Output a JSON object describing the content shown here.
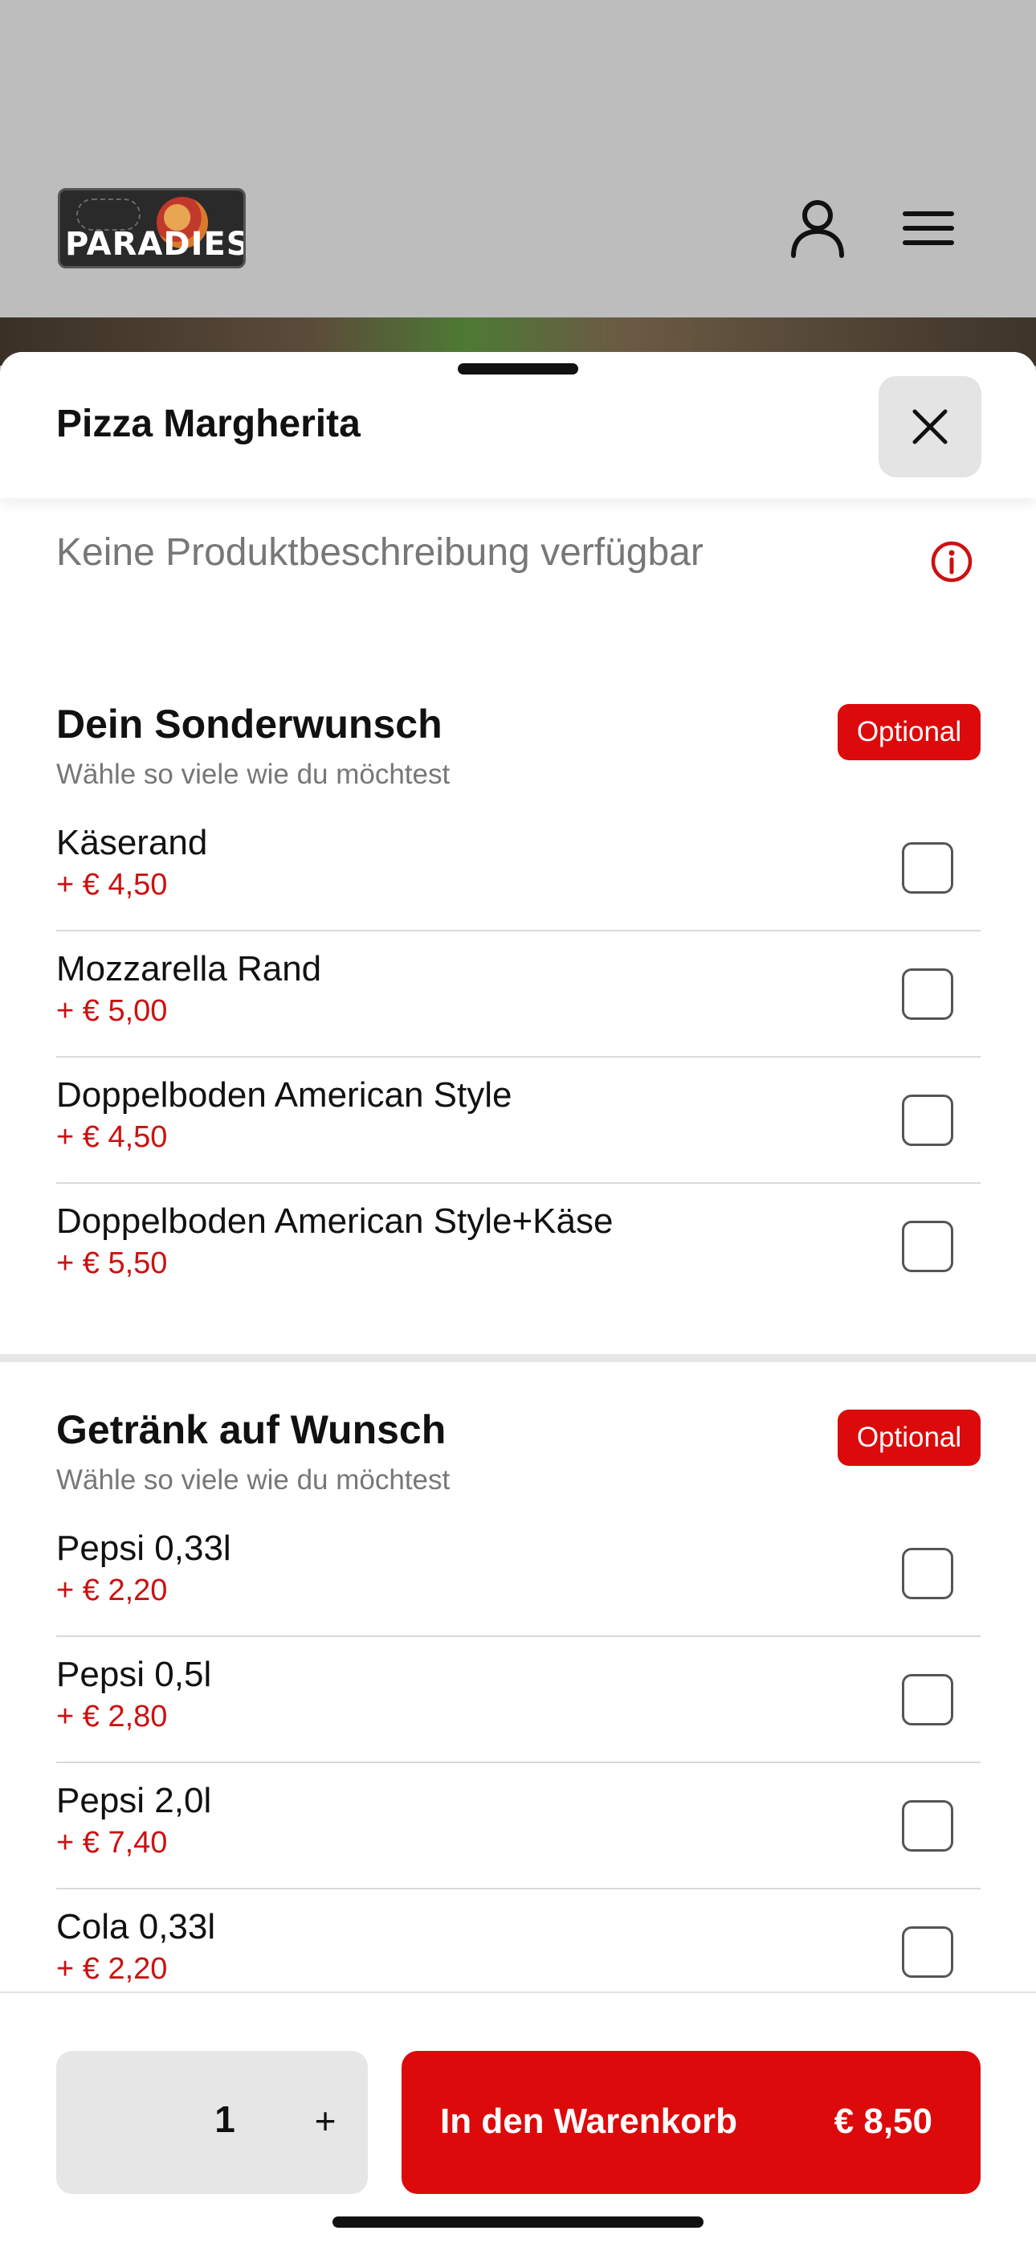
{
  "header": {
    "logo_text": "PARADIES",
    "user_icon": "user-icon",
    "menu_icon": "hamburger-menu-icon"
  },
  "sheet": {
    "title": "Pizza Margherita",
    "close_icon": "close-icon",
    "description": "Keine Produktbeschreibung verfügbar",
    "info_icon": "info-icon"
  },
  "sections": [
    {
      "title": "Dein Sonderwunsch",
      "subtitle": "Wähle so viele wie du möchtest",
      "badge": "Optional",
      "options": [
        {
          "name": "Käserand",
          "price": "+ € 4,50",
          "checked": false
        },
        {
          "name": "Mozzarella Rand",
          "price": "+ € 5,00",
          "checked": false
        },
        {
          "name": "Doppelboden American Style",
          "price": "+ € 4,50",
          "checked": false
        },
        {
          "name": "Doppelboden American Style+Käse",
          "price": "+ € 5,50",
          "checked": false
        }
      ]
    },
    {
      "title": "Getränk auf Wunsch",
      "subtitle": "Wähle so viele wie du möchtest",
      "badge": "Optional",
      "options": [
        {
          "name": "Pepsi 0,33l",
          "price": "+ € 2,20",
          "checked": false
        },
        {
          "name": "Pepsi 0,5l",
          "price": "+ € 2,80",
          "checked": false
        },
        {
          "name": "Pepsi 2,0l",
          "price": "+ € 7,40",
          "checked": false
        },
        {
          "name": "Cola 0,33l",
          "price": "+ € 2,20",
          "checked": false
        }
      ]
    }
  ],
  "footer": {
    "quantity": "1",
    "plus_label": "+",
    "cart_label": "In den Warenkorb",
    "cart_price": "€ 8,50"
  },
  "colors": {
    "accent": "#dc0a0a",
    "price": "#cc1111"
  }
}
